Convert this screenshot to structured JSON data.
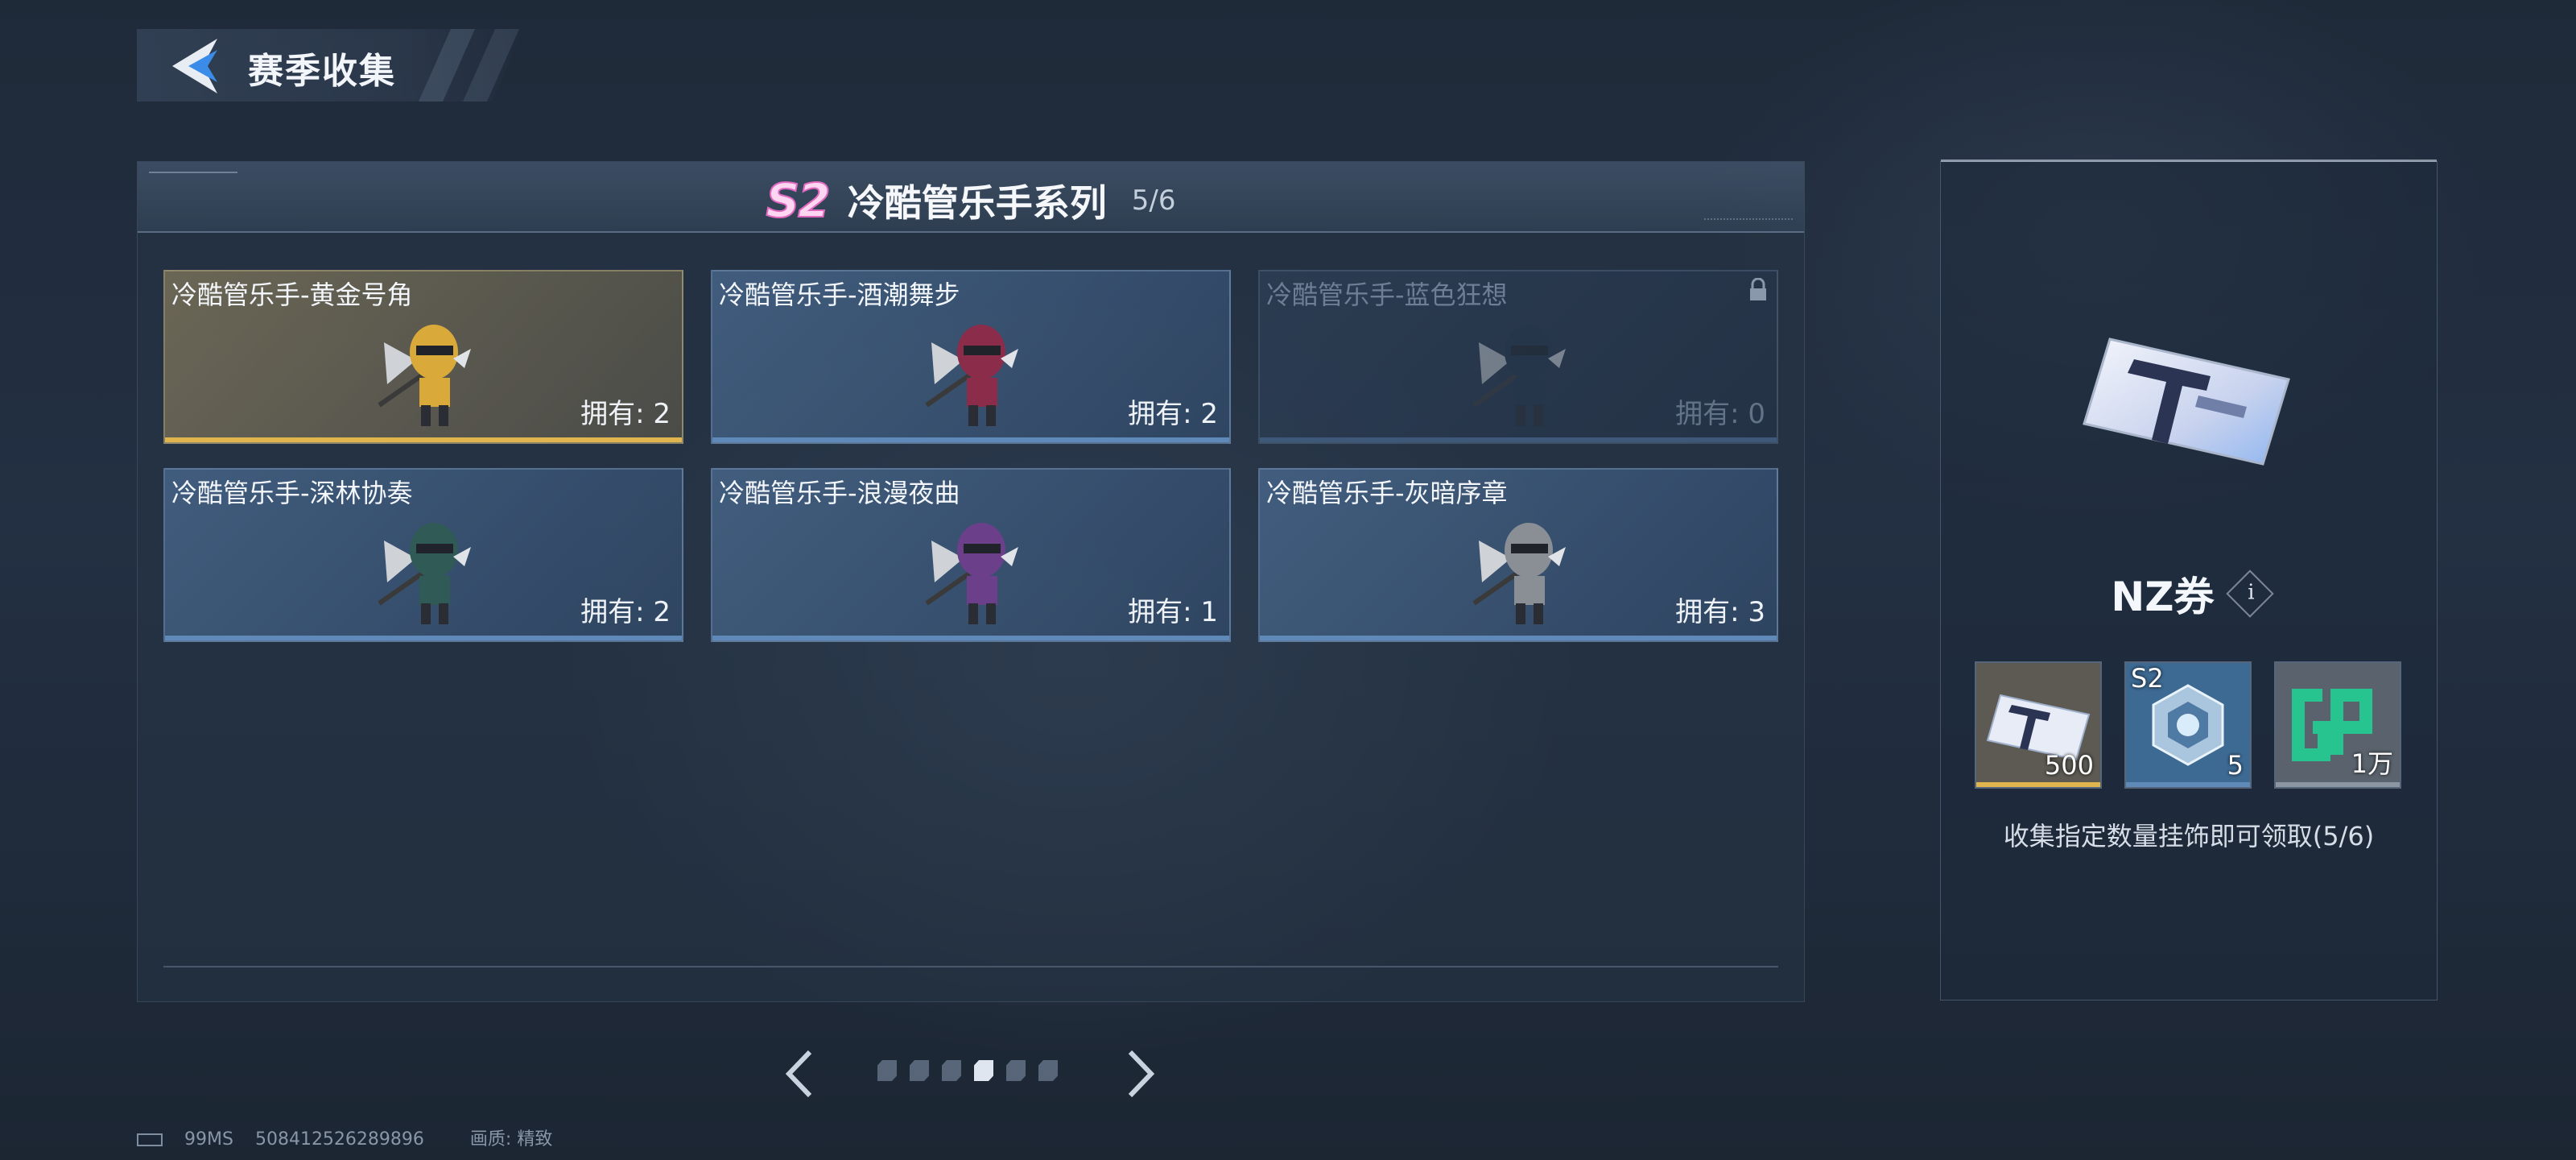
{
  "header": {
    "title": "赛季收集"
  },
  "series": {
    "season_tag": "S2",
    "name": "冷酷管乐手系列",
    "progress": "5/6"
  },
  "cards": [
    {
      "name": "冷酷管乐手-黄金号角",
      "count": "拥有: 2",
      "style": "gold",
      "accent": "#e1b54e",
      "figure_color": "#d9a93a"
    },
    {
      "name": "冷酷管乐手-酒潮舞步",
      "count": "拥有: 2",
      "style": "blue",
      "accent": "#5f89b8",
      "figure_color": "#8a2c4a"
    },
    {
      "name": "冷酷管乐手-蓝色狂想",
      "count": "拥有: 0",
      "style": "locked",
      "accent": "#3d5878",
      "figure_color": "#24354a",
      "locked_icon": "lock-icon"
    },
    {
      "name": "冷酷管乐手-深林协奏",
      "count": "拥有: 2",
      "style": "blue",
      "accent": "#5f89b8",
      "figure_color": "#2f5a55"
    },
    {
      "name": "冷酷管乐手-浪漫夜曲",
      "count": "拥有: 1",
      "style": "blue",
      "accent": "#5f89b8",
      "figure_color": "#6b3f8a"
    },
    {
      "name": "冷酷管乐手-灰暗序章",
      "count": "拥有: 3",
      "style": "blue",
      "accent": "#5f89b8",
      "figure_color": "#8a8f96"
    }
  ],
  "pager": {
    "total": 6,
    "active_index": 3
  },
  "reward": {
    "title": "NZ券",
    "info_glyph": "i",
    "items": [
      {
        "qty": "500",
        "tag": "",
        "icon": "ticket-icon",
        "accent": "#e1b54e"
      },
      {
        "qty": "5",
        "tag": "S2",
        "icon": "crystal-icon",
        "accent": "#5f89b8"
      },
      {
        "qty": "1万",
        "tag": "",
        "icon": "gp-coin-icon",
        "accent": "#8c96a3"
      }
    ],
    "description": "收集指定数量挂饰即可领取(5/6)"
  },
  "footer": {
    "latency": "99MS",
    "player_id": "508412526289896",
    "quality": "画质: 精致"
  }
}
